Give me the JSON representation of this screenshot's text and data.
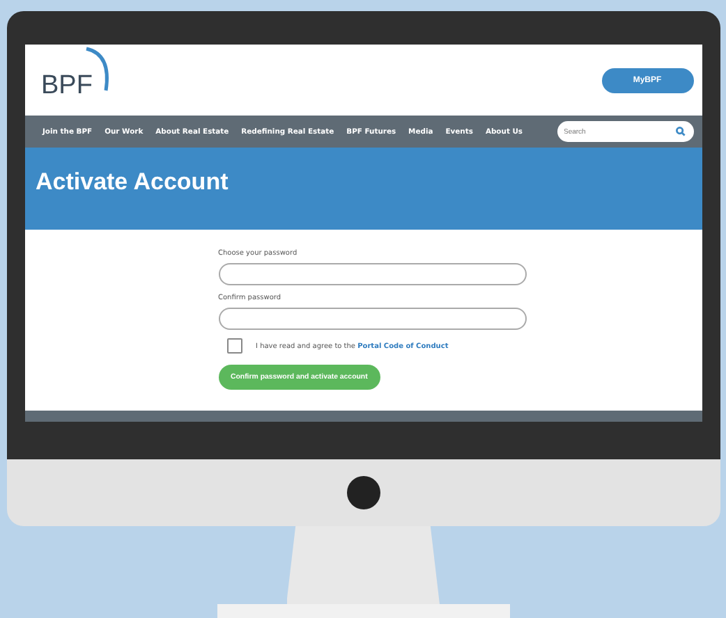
{
  "header": {
    "logo": "BPF",
    "account_button": "MyBPF"
  },
  "nav": {
    "items": [
      {
        "label": "Join the BPF"
      },
      {
        "label": "Our Work"
      },
      {
        "label": "About Real Estate"
      },
      {
        "label": "Redefining Real Estate"
      },
      {
        "label": "BPF Futures"
      },
      {
        "label": "Media"
      },
      {
        "label": "Events"
      },
      {
        "label": "About Us"
      }
    ],
    "search": {
      "placeholder": "Search"
    }
  },
  "banner": {
    "title": "Activate Account"
  },
  "form": {
    "fields": [
      {
        "label": "Choose your password"
      },
      {
        "label": "Confirm password"
      }
    ],
    "agreement": {
      "checked": false,
      "text": "I have read and agree to the",
      "link": "Portal Code of Conduct"
    },
    "submit": "Confirm password and activate account"
  }
}
